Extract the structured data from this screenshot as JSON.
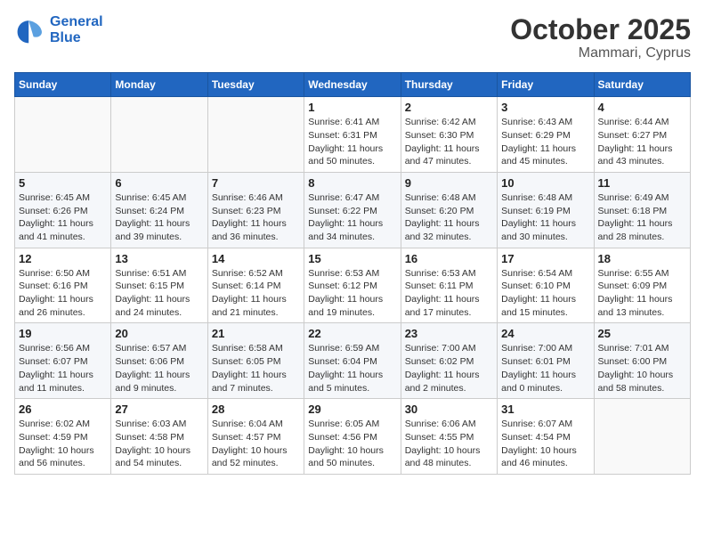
{
  "header": {
    "logo_line1": "General",
    "logo_line2": "Blue",
    "month": "October 2025",
    "location": "Mammari, Cyprus"
  },
  "weekdays": [
    "Sunday",
    "Monday",
    "Tuesday",
    "Wednesday",
    "Thursday",
    "Friday",
    "Saturday"
  ],
  "weeks": [
    [
      {
        "day": "",
        "detail": ""
      },
      {
        "day": "",
        "detail": ""
      },
      {
        "day": "",
        "detail": ""
      },
      {
        "day": "1",
        "detail": "Sunrise: 6:41 AM\nSunset: 6:31 PM\nDaylight: 11 hours\nand 50 minutes."
      },
      {
        "day": "2",
        "detail": "Sunrise: 6:42 AM\nSunset: 6:30 PM\nDaylight: 11 hours\nand 47 minutes."
      },
      {
        "day": "3",
        "detail": "Sunrise: 6:43 AM\nSunset: 6:29 PM\nDaylight: 11 hours\nand 45 minutes."
      },
      {
        "day": "4",
        "detail": "Sunrise: 6:44 AM\nSunset: 6:27 PM\nDaylight: 11 hours\nand 43 minutes."
      }
    ],
    [
      {
        "day": "5",
        "detail": "Sunrise: 6:45 AM\nSunset: 6:26 PM\nDaylight: 11 hours\nand 41 minutes."
      },
      {
        "day": "6",
        "detail": "Sunrise: 6:45 AM\nSunset: 6:24 PM\nDaylight: 11 hours\nand 39 minutes."
      },
      {
        "day": "7",
        "detail": "Sunrise: 6:46 AM\nSunset: 6:23 PM\nDaylight: 11 hours\nand 36 minutes."
      },
      {
        "day": "8",
        "detail": "Sunrise: 6:47 AM\nSunset: 6:22 PM\nDaylight: 11 hours\nand 34 minutes."
      },
      {
        "day": "9",
        "detail": "Sunrise: 6:48 AM\nSunset: 6:20 PM\nDaylight: 11 hours\nand 32 minutes."
      },
      {
        "day": "10",
        "detail": "Sunrise: 6:48 AM\nSunset: 6:19 PM\nDaylight: 11 hours\nand 30 minutes."
      },
      {
        "day": "11",
        "detail": "Sunrise: 6:49 AM\nSunset: 6:18 PM\nDaylight: 11 hours\nand 28 minutes."
      }
    ],
    [
      {
        "day": "12",
        "detail": "Sunrise: 6:50 AM\nSunset: 6:16 PM\nDaylight: 11 hours\nand 26 minutes."
      },
      {
        "day": "13",
        "detail": "Sunrise: 6:51 AM\nSunset: 6:15 PM\nDaylight: 11 hours\nand 24 minutes."
      },
      {
        "day": "14",
        "detail": "Sunrise: 6:52 AM\nSunset: 6:14 PM\nDaylight: 11 hours\nand 21 minutes."
      },
      {
        "day": "15",
        "detail": "Sunrise: 6:53 AM\nSunset: 6:12 PM\nDaylight: 11 hours\nand 19 minutes."
      },
      {
        "day": "16",
        "detail": "Sunrise: 6:53 AM\nSunset: 6:11 PM\nDaylight: 11 hours\nand 17 minutes."
      },
      {
        "day": "17",
        "detail": "Sunrise: 6:54 AM\nSunset: 6:10 PM\nDaylight: 11 hours\nand 15 minutes."
      },
      {
        "day": "18",
        "detail": "Sunrise: 6:55 AM\nSunset: 6:09 PM\nDaylight: 11 hours\nand 13 minutes."
      }
    ],
    [
      {
        "day": "19",
        "detail": "Sunrise: 6:56 AM\nSunset: 6:07 PM\nDaylight: 11 hours\nand 11 minutes."
      },
      {
        "day": "20",
        "detail": "Sunrise: 6:57 AM\nSunset: 6:06 PM\nDaylight: 11 hours\nand 9 minutes."
      },
      {
        "day": "21",
        "detail": "Sunrise: 6:58 AM\nSunset: 6:05 PM\nDaylight: 11 hours\nand 7 minutes."
      },
      {
        "day": "22",
        "detail": "Sunrise: 6:59 AM\nSunset: 6:04 PM\nDaylight: 11 hours\nand 5 minutes."
      },
      {
        "day": "23",
        "detail": "Sunrise: 7:00 AM\nSunset: 6:02 PM\nDaylight: 11 hours\nand 2 minutes."
      },
      {
        "day": "24",
        "detail": "Sunrise: 7:00 AM\nSunset: 6:01 PM\nDaylight: 11 hours\nand 0 minutes."
      },
      {
        "day": "25",
        "detail": "Sunrise: 7:01 AM\nSunset: 6:00 PM\nDaylight: 10 hours\nand 58 minutes."
      }
    ],
    [
      {
        "day": "26",
        "detail": "Sunrise: 6:02 AM\nSunset: 4:59 PM\nDaylight: 10 hours\nand 56 minutes."
      },
      {
        "day": "27",
        "detail": "Sunrise: 6:03 AM\nSunset: 4:58 PM\nDaylight: 10 hours\nand 54 minutes."
      },
      {
        "day": "28",
        "detail": "Sunrise: 6:04 AM\nSunset: 4:57 PM\nDaylight: 10 hours\nand 52 minutes."
      },
      {
        "day": "29",
        "detail": "Sunrise: 6:05 AM\nSunset: 4:56 PM\nDaylight: 10 hours\nand 50 minutes."
      },
      {
        "day": "30",
        "detail": "Sunrise: 6:06 AM\nSunset: 4:55 PM\nDaylight: 10 hours\nand 48 minutes."
      },
      {
        "day": "31",
        "detail": "Sunrise: 6:07 AM\nSunset: 4:54 PM\nDaylight: 10 hours\nand 46 minutes."
      },
      {
        "day": "",
        "detail": ""
      }
    ]
  ]
}
